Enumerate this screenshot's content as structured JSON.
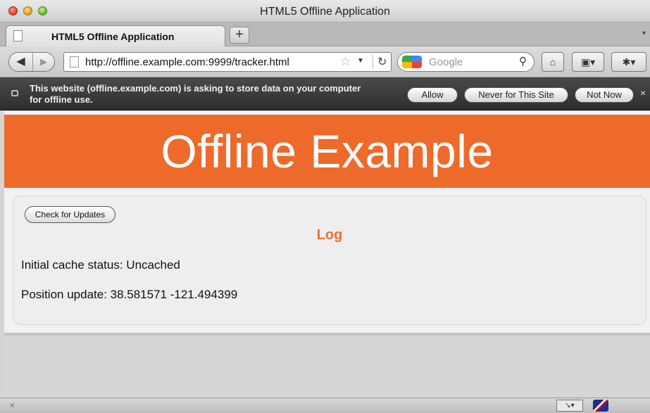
{
  "window": {
    "title": "HTML5 Offline Application"
  },
  "tabs": [
    {
      "label": "HTML5 Offline Application"
    }
  ],
  "toolbar": {
    "new_tab_label": "+",
    "url": "http://offline.example.com:9999/tracker.html",
    "search_placeholder": "Google",
    "back_icon": "back-arrow-icon",
    "forward_icon": "forward-arrow-icon",
    "home_icon": "home-icon",
    "bookmarks_icon": "bookmarks-icon"
  },
  "notification": {
    "message": "This website (offline.example.com) is asking to store data on your computer for offline use.",
    "buttons": {
      "allow": "Allow",
      "never": "Never for This Site",
      "not_now": "Not Now"
    },
    "close_label": "×"
  },
  "page": {
    "banner_title": "Offline Example",
    "banner_color": "#ee6a2b",
    "check_button": "Check for Updates",
    "log_title": "Log",
    "log_title_color": "#e8722f",
    "log_lines": [
      "Initial cache status: Uncached",
      "Position update: 38.581571 -121.494399"
    ]
  },
  "status": {
    "close_label": "×"
  }
}
